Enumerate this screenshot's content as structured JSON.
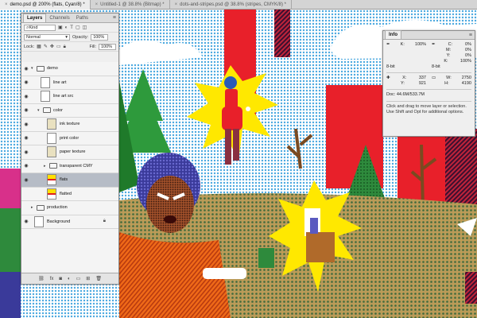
{
  "tabs": [
    {
      "label": "demo.psd @ 200% (flats, Cyan/8) *",
      "active": true
    },
    {
      "label": "Untitled-1 @ 38.8% (Bitmap) *",
      "active": false
    },
    {
      "label": "dots-and-stripes.psd @ 38.8% (stripes, CMYK/8) *",
      "active": false
    }
  ],
  "layers_panel": {
    "tabs": [
      "Layers",
      "Channels",
      "Paths"
    ],
    "kind_label": "Kind",
    "blend_mode": "Normal",
    "opacity_label": "Opacity:",
    "opacity_value": "100%",
    "lock_label": "Lock:",
    "fill_label": "Fill:",
    "fill_value": "100%",
    "layers": [
      {
        "name": "demo",
        "type": "group",
        "indent": 0,
        "selected": false
      },
      {
        "name": "line art",
        "type": "layer",
        "indent": 1,
        "selected": false
      },
      {
        "name": "line art src",
        "type": "layer",
        "indent": 1,
        "selected": false
      },
      {
        "name": "color",
        "type": "group",
        "indent": 1,
        "selected": false
      },
      {
        "name": "ink texture",
        "type": "layer",
        "indent": 2,
        "selected": false
      },
      {
        "name": "print color",
        "type": "layer",
        "indent": 2,
        "selected": false
      },
      {
        "name": "paper texture",
        "type": "layer",
        "indent": 2,
        "selected": false
      },
      {
        "name": "transparent CMY",
        "type": "group",
        "indent": 2,
        "selected": false
      },
      {
        "name": "flats",
        "type": "art",
        "indent": 2,
        "selected": true
      },
      {
        "name": "flatted",
        "type": "art",
        "indent": 2,
        "selected": false
      },
      {
        "name": "production",
        "type": "group",
        "indent": 0,
        "selected": false
      },
      {
        "name": "Background",
        "type": "layer",
        "indent": 0,
        "selected": false,
        "locked": true
      }
    ]
  },
  "info_panel": {
    "title": "Info",
    "k_label": "K:",
    "k_value": "100%",
    "bit_left": "8-bit",
    "c_label": "C:",
    "c_value": "0%",
    "m_label": "M:",
    "m_value": "0%",
    "y_label": "Y:",
    "y_value": "0%",
    "k2_label": "K:",
    "k2_value": "100%",
    "bit_right": "8-bit",
    "x_label": "X:",
    "x_value": "337",
    "ypos_label": "Y:",
    "ypos_value": "921",
    "w_label": "W:",
    "w_value": "2750",
    "h_label": "H:",
    "h_value": "4190",
    "doc": "Doc: 44.6M/533.7M",
    "help": "Click and drag to move layer or selection. Use Shift and Opt for additional options."
  }
}
